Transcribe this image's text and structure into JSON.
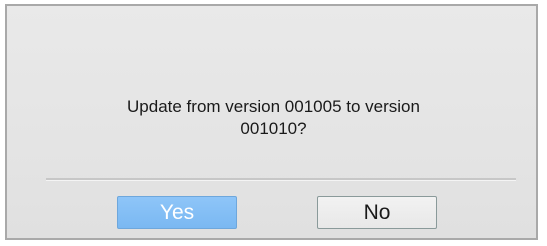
{
  "dialog": {
    "message_line1": "Update from version 001005 to version",
    "message_line2": "001010?",
    "yes_label": "Yes",
    "no_label": "No"
  },
  "colors": {
    "yes_button": "#7ab8f2",
    "no_button": "#efefef",
    "dialog_background": "#e6e6e6"
  }
}
